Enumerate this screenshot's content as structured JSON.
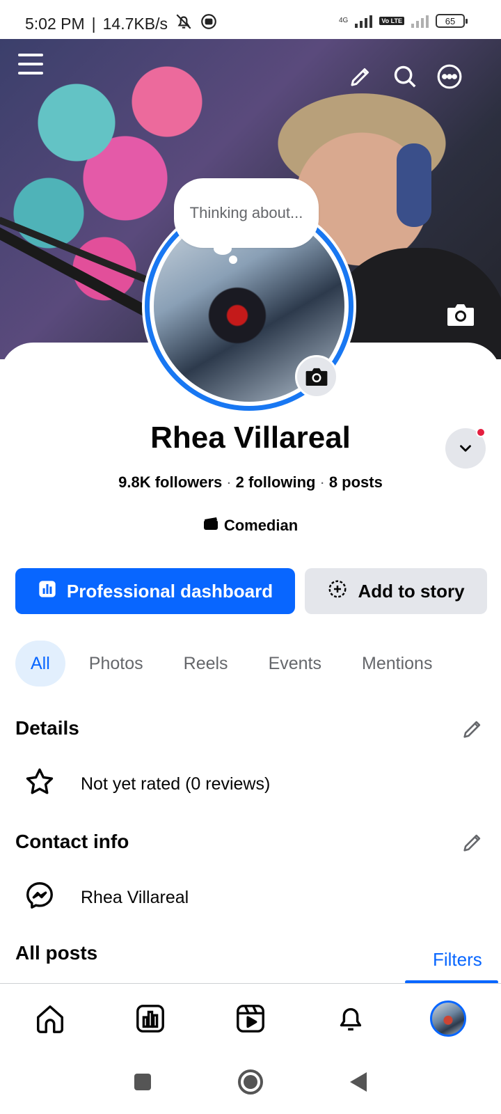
{
  "status_bar": {
    "time": "5:02 PM",
    "separator": "|",
    "net_speed": "14.7KB/s",
    "network_type": "4G",
    "volte": "Vo LTE",
    "battery": "65"
  },
  "cover": {
    "menu_icon": "hamburger-icon",
    "edit_icon": "pencil-icon",
    "search_icon": "search-icon",
    "more_icon": "more-icon",
    "camera_icon": "camera-icon"
  },
  "profile": {
    "thought_bubble": "Thinking about...",
    "name": "Rhea Villareal",
    "followers": "9.8K followers",
    "following": "2 following",
    "posts": "8 posts",
    "stats_separator": "·",
    "category": "Comedian",
    "notification_color": "#e41e3f"
  },
  "actions": {
    "primary_label": "Professional dashboard",
    "secondary_label": "Add to story",
    "primary_color": "#0866ff"
  },
  "tabs": [
    {
      "label": "All",
      "active": true
    },
    {
      "label": "Photos",
      "active": false
    },
    {
      "label": "Reels",
      "active": false
    },
    {
      "label": "Events",
      "active": false
    },
    {
      "label": "Mentions",
      "active": false
    }
  ],
  "details": {
    "title": "Details",
    "rating_text": "Not yet rated (0 reviews)"
  },
  "contact": {
    "title": "Contact info",
    "messenger_name": "Rhea Villareal"
  },
  "posts": {
    "title": "All posts",
    "filters_label": "Filters"
  },
  "bottom_nav": [
    "home-icon",
    "dashboard-icon",
    "reels-icon",
    "notifications-icon",
    "profile-avatar"
  ],
  "system_nav": [
    "recents-button",
    "home-button",
    "back-button"
  ]
}
